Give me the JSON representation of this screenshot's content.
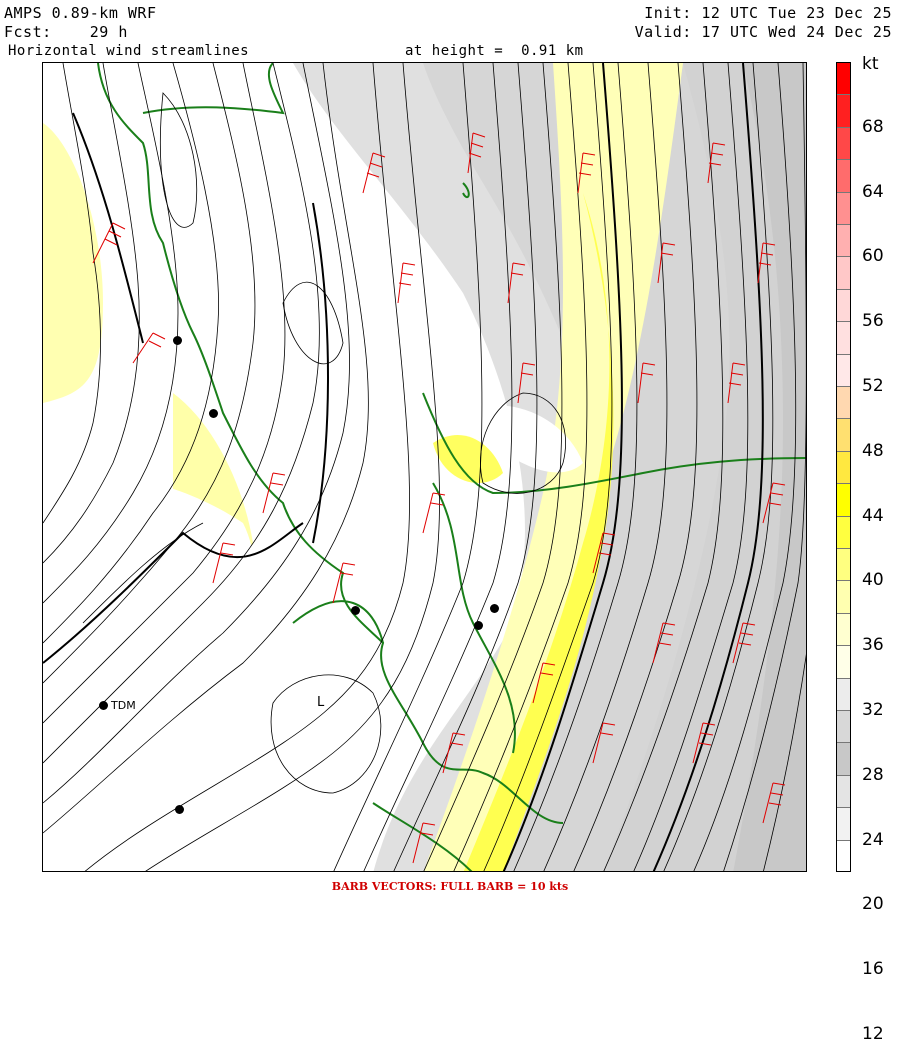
{
  "header": {
    "model": "AMPS 0.89-km WRF",
    "init": "Init: 12 UTC Tue 23 Dec 25",
    "fcst": "Fcst:    29 h",
    "valid": "Valid: 17 UTC Wed 24 Dec 25",
    "field": "Horizontal wind streamlines",
    "height": "at height =  0.91 km"
  },
  "colorbar": {
    "unit": "kt",
    "ticks": [
      "68",
      "64",
      "60",
      "56",
      "52",
      "48",
      "44",
      "40",
      "36",
      "32",
      "28",
      "24",
      "20",
      "16",
      "12"
    ],
    "colors": [
      "#ff0000",
      "#ff2020",
      "#ff4848",
      "#ff6c6c",
      "#ff9090",
      "#ffb0b0",
      "#ffc8c8",
      "#ffd8d8",
      "#ffe0e0",
      "#ffe8e8",
      "#ffd8b0",
      "#ffe070",
      "#ffe840",
      "#ffff00",
      "#ffff40",
      "#ffff80",
      "#ffffb0",
      "#ffffd0",
      "#ffffe8",
      "#ececec",
      "#d8d8d8",
      "#c8c8c8",
      "#e4e4e4",
      "#f2f2f2",
      "#ffffff"
    ]
  },
  "map": {
    "low_marker": "L",
    "station_label": "TDM"
  },
  "footer": "BARB VECTORS:  FULL BARB = 10 kts"
}
